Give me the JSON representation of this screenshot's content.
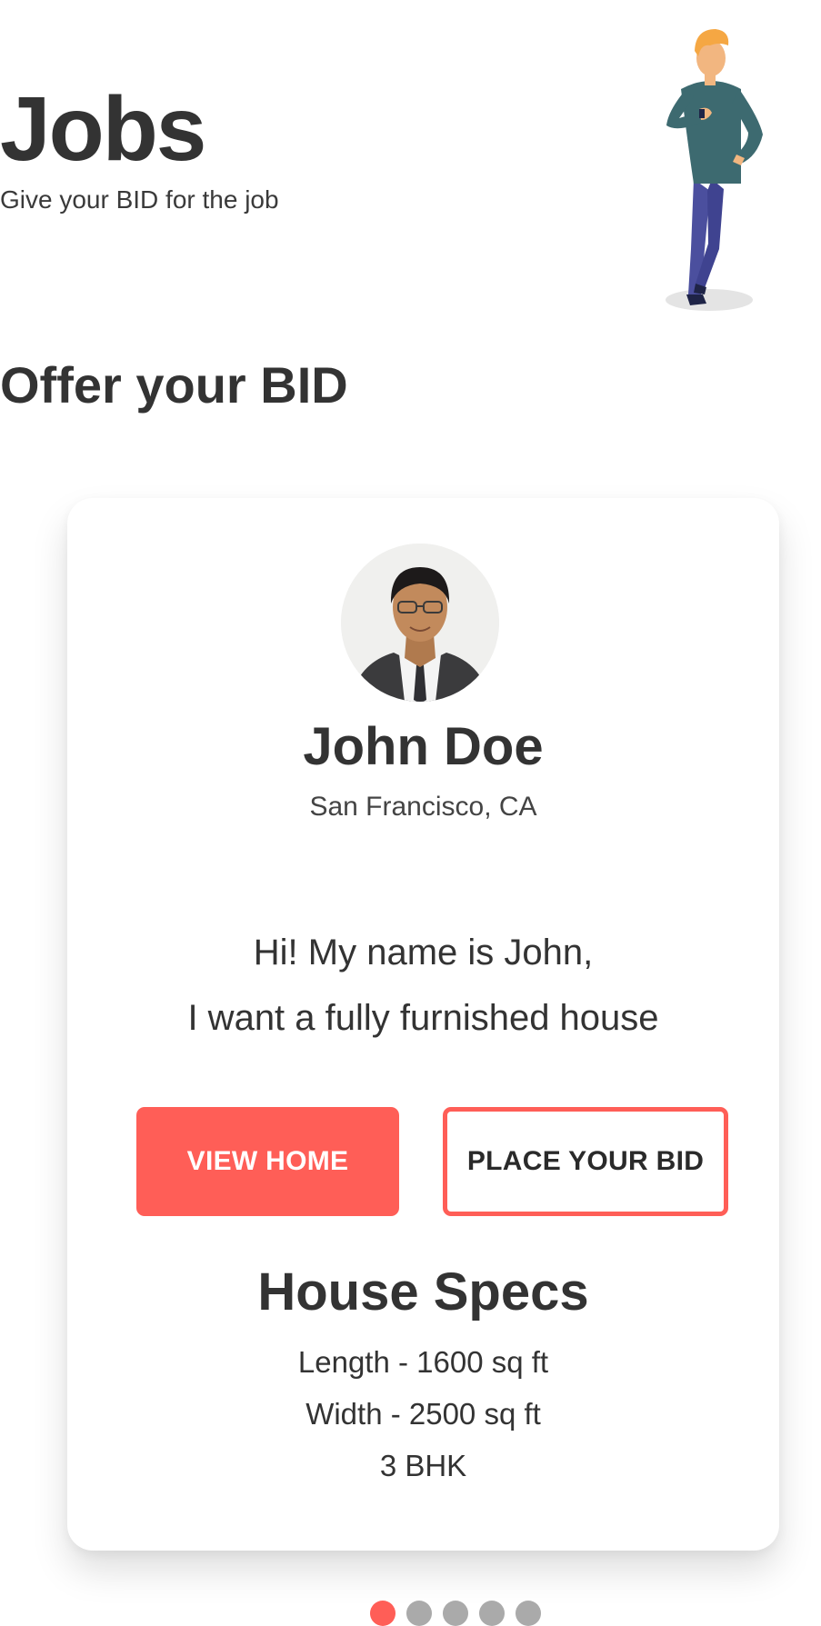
{
  "header": {
    "title": "Jobs",
    "subtitle": "Give your BID for the job"
  },
  "section": {
    "title": "Offer your BID"
  },
  "card": {
    "name": "John Doe",
    "location": "San Francisco, CA",
    "message_lines": [
      "Hi! My name is John,",
      "I want a fully furnished house"
    ],
    "buttons": {
      "view_home": "VIEW HOME",
      "place_bid": "PLACE YOUR BID"
    },
    "specs": {
      "title": "House Specs",
      "items": [
        "Length - 1600 sq ft",
        "Width - 2500 sq ft",
        "3 BHK"
      ]
    }
  },
  "pagination": {
    "count": 5,
    "active_index": 0
  },
  "colors": {
    "accent": "#ff5e57",
    "text": "#333333",
    "dot_inactive": "#aaaaaa"
  }
}
